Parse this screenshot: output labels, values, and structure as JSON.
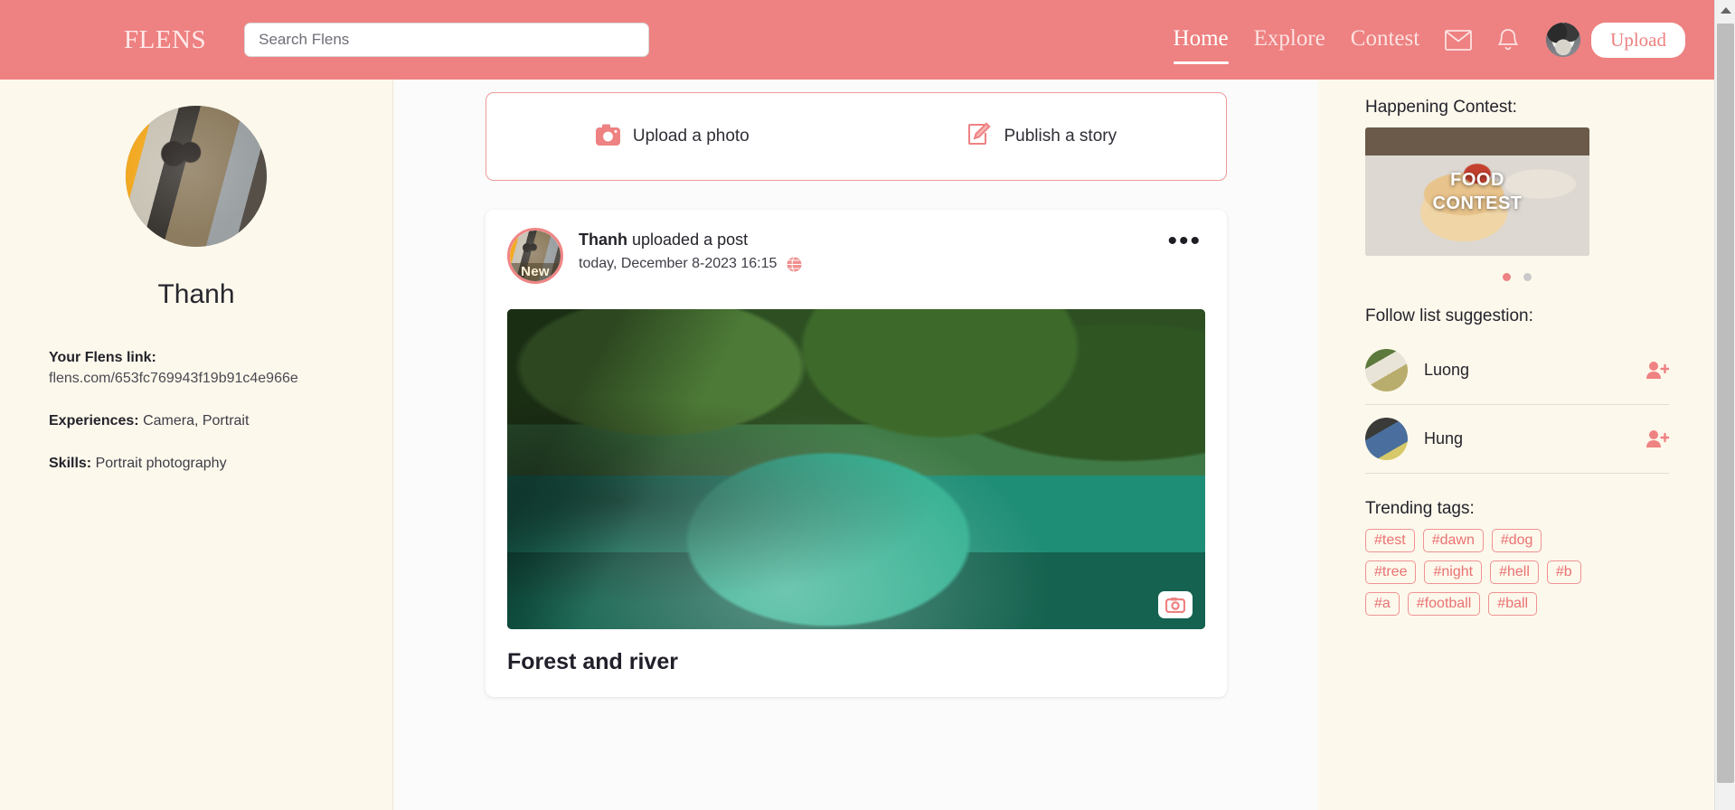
{
  "header": {
    "brand": "FLENS",
    "search": {
      "placeholder": "Search Flens",
      "value": ""
    },
    "nav": [
      {
        "label": "Home",
        "active": true
      },
      {
        "label": "Explore",
        "active": false
      },
      {
        "label": "Contest",
        "active": false
      }
    ],
    "icons": {
      "messages": "envelope-icon",
      "notifications": "bell-icon",
      "avatar": "user-avatar-dog"
    },
    "upload_label": "Upload",
    "bg_color": "#ee8181",
    "accent_color": "#ee8181"
  },
  "sidebar": {
    "avatar_alt": "profile-photo-man-with-backpack",
    "name": "Thanh",
    "link_label": "Your Flens link:",
    "link_value": "flens.com/653fc769943f19b91c4e966e",
    "experiences_label": "Experiences:",
    "experiences_value": "Camera, Portrait",
    "skills_label": "Skills:",
    "skills_value": "Portrait photography"
  },
  "composer": {
    "upload_photo_label": "Upload a photo",
    "upload_photo_icon": "camera-icon",
    "publish_story_label": "Publish a story",
    "publish_story_icon": "pencil-edit-icon"
  },
  "post": {
    "author": "Thanh",
    "action_text": " uploaded a post",
    "badge": "New",
    "timestamp": "today, December 8-2023 16:15",
    "visibility_icon": "globe-icon",
    "menu_icon": "ellipsis-icon",
    "photo_alt": "forest-and-river-photo",
    "photo_badge_icon": "camera-icon",
    "photo_title": "Forest and river"
  },
  "right": {
    "contest_heading": "Happening Contest:",
    "contest_banner_line1": "FOOD",
    "contest_banner_line2": "CONTEST",
    "carousel_dots": 2,
    "carousel_active": 0,
    "follow_heading": "Follow list suggestion:",
    "follow_list": [
      {
        "name": "Luong",
        "icon": "person-add-icon"
      },
      {
        "name": "Hung",
        "icon": "person-add-icon"
      }
    ],
    "tags_heading": "Trending tags:",
    "tags": [
      "#test",
      "#dawn",
      "#dog",
      "#tree",
      "#night",
      "#hell",
      "#b",
      "#a",
      "#football",
      "#ball"
    ]
  },
  "scrollbar": {
    "up_arrow": "triangle-up-icon"
  }
}
